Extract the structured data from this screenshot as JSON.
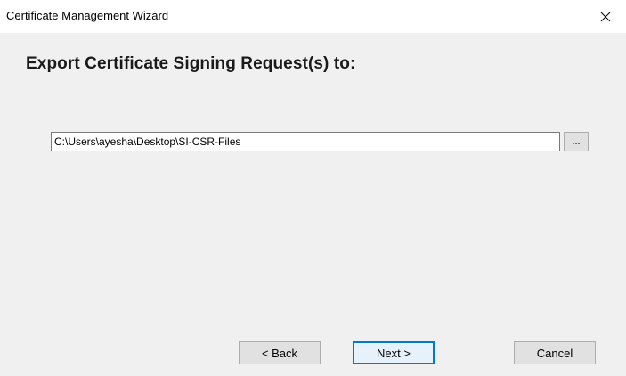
{
  "window": {
    "title": "Certificate Management Wizard",
    "close_icon": "close-icon"
  },
  "main": {
    "heading": "Export Certificate Signing Request(s) to:",
    "path_value": "C:\\Users\\ayesha\\Desktop\\SI-CSR-Files",
    "browse_label": "..."
  },
  "footer": {
    "back_label": "< Back",
    "next_label": "Next >",
    "cancel_label": "Cancel"
  },
  "colors": {
    "dialog_background": "#f0f0f0",
    "titlebar_background": "#ffffff",
    "default_button_border": "#0078d7"
  }
}
